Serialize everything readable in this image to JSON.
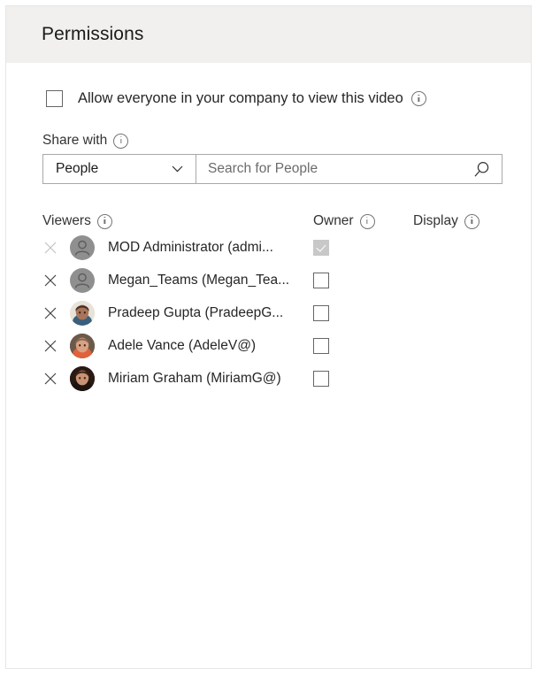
{
  "card": {
    "title": "Permissions"
  },
  "allow_everyone": {
    "label": "Allow everyone in your company to view this video",
    "checked": false,
    "info_icon": "info-icon"
  },
  "share_with": {
    "label": "Share with",
    "info_icon": "info-icon",
    "dropdown": {
      "selected": "People",
      "chevron_icon": "chevron-down-icon",
      "options": [
        "People"
      ]
    },
    "search": {
      "value": "",
      "placeholder": "Search for People",
      "icon": "search-icon"
    }
  },
  "table": {
    "headers": {
      "viewers": "Viewers",
      "owner": "Owner",
      "display": "Display",
      "info_icon": "info-icon"
    },
    "remove_icon": "close-x-icon",
    "rows": [
      {
        "name": "MOD Administrator (admi...",
        "avatar": "person-placeholder-icon",
        "avatar_type": "placeholder",
        "owner_checked": true,
        "owner_disabled": true,
        "remove_disabled": true
      },
      {
        "name": "Megan_Teams (Megan_Tea...",
        "avatar": "person-placeholder-icon",
        "avatar_type": "placeholder",
        "owner_checked": false,
        "owner_disabled": false,
        "remove_disabled": false
      },
      {
        "name": "Pradeep Gupta (PradeepG...",
        "avatar": "person-photo",
        "avatar_type": "photo",
        "avatar_colors": [
          "#e8e3d8",
          "#4a2e22",
          "#a9755a",
          "#3a5f7d"
        ],
        "owner_checked": false,
        "owner_disabled": false,
        "remove_disabled": false
      },
      {
        "name": "Adele Vance (AdeleV@)",
        "avatar": "person-photo",
        "avatar_type": "photo",
        "avatar_colors": [
          "#6b5a4a",
          "#8a6a52",
          "#d9a183",
          "#e0613a"
        ],
        "owner_checked": false,
        "owner_disabled": false,
        "remove_disabled": false
      },
      {
        "name": "Miriam Graham (MiriamG@)",
        "avatar": "person-photo",
        "avatar_type": "photo",
        "avatar_colors": [
          "#2a1a14",
          "#3d2419",
          "#c99273",
          "#1d1410"
        ],
        "owner_checked": false,
        "owner_disabled": false,
        "remove_disabled": false
      }
    ]
  },
  "colors": {
    "header_bg": "#f1f0ee",
    "card_border": "#e6e6e6",
    "text": "#262626",
    "muted_text": "#6b6b6b",
    "control_border": "#a9a9a9",
    "checkbox_border": "#666666",
    "checked_fill": "#c8c8c8",
    "avatar_placeholder": "#8f8f8f"
  }
}
